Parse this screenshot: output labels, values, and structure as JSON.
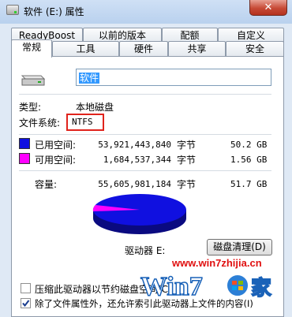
{
  "window": {
    "title": "软件 (E:) 属性",
    "close_glyph": "✕"
  },
  "tabs": {
    "row1": [
      "ReadyBoost",
      "以前的版本",
      "配额",
      "自定义"
    ],
    "row2": [
      "常规",
      "工具",
      "硬件",
      "共享",
      "安全"
    ],
    "active": "常规"
  },
  "general": {
    "drive_name": "软件",
    "type_label": "类型:",
    "type_value": "本地磁盘",
    "fs_label": "文件系统:",
    "fs_value": "NTFS",
    "used_label": "已用空间:",
    "used_bytes": "53,921,443,840",
    "used_unit": "字节",
    "used_size": "50.2 GB",
    "free_label": "可用空间:",
    "free_bytes": "1,684,537,344",
    "free_unit": "字节",
    "free_size": "1.56 GB",
    "capacity_label": "容量:",
    "capacity_bytes": "55,605,981,184",
    "capacity_unit": "字节",
    "capacity_size": "51.7 GB",
    "drive_label": "驱动器 E:",
    "cleanup_button": "磁盘清理(D)",
    "compress_label": "压缩此驱动器以节约磁盘空间(C)",
    "compress_checked": false,
    "index_label": "除了文件属性外，还允许索引此驱动器上文件的内容(I)",
    "index_checked": true
  },
  "colors": {
    "used": "#1010e0",
    "free": "#ff00ff",
    "highlight_box": "#e0231c"
  },
  "watermark": {
    "url": "www.win7zhijia.cn",
    "logo_text": "Win7",
    "logo_suffix": "家"
  }
}
